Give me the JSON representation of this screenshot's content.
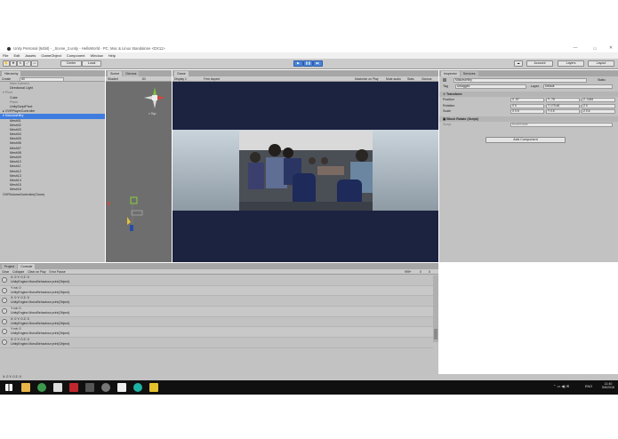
{
  "window": {
    "title": "Unity Personal (64bit) - _Scene_2.unity - HelloWorld - PC, Mac & Linux Standalone <DX11>",
    "minimize": "—",
    "maximize": "☐",
    "close": "✕"
  },
  "menu": [
    "File",
    "Edit",
    "Assets",
    "GameObject",
    "Component",
    "Window",
    "Help"
  ],
  "toolbar": {
    "pivot": "Center",
    "space": "Local",
    "account": "Account",
    "layers": "Layers",
    "layout": "Layout"
  },
  "hierarchy": {
    "tab": "Hierarchy",
    "create": "Create",
    "search_placeholder": "All",
    "items": [
      {
        "label": "Main Camera",
        "level": 1,
        "dim": true
      },
      {
        "label": "Directional Light",
        "level": 1,
        "dim": false
      },
      {
        "label": "▾ Pivot",
        "level": 0,
        "dim": true
      },
      {
        "label": "Cube",
        "level": 1,
        "dim": false
      },
      {
        "label": "Plane",
        "level": 1,
        "dim": true
      },
      {
        "label": "UnityScriptPivot",
        "level": 1,
        "dim": false
      },
      {
        "label": "▸ OVRPlayerController",
        "level": 0,
        "dim": false
      },
      {
        "label": "▾ MatureaHitry",
        "level": 0,
        "dim": false,
        "selected": true
      },
      {
        "label": "Mesh01",
        "level": 1
      },
      {
        "label": "Mesh02",
        "level": 1
      },
      {
        "label": "Mesh03",
        "level": 1
      },
      {
        "label": "Mesh04",
        "level": 1
      },
      {
        "label": "Mesh05",
        "level": 1
      },
      {
        "label": "Mesh06",
        "level": 1
      },
      {
        "label": "Mesh07",
        "level": 1
      },
      {
        "label": "Mesh08",
        "level": 1
      },
      {
        "label": "Mesh09",
        "level": 1
      },
      {
        "label": "Mesh10",
        "level": 1
      },
      {
        "label": "Mesh11",
        "level": 1
      },
      {
        "label": "Mesh12",
        "level": 1
      },
      {
        "label": "Mesh13",
        "level": 1
      },
      {
        "label": "Mesh14",
        "level": 1
      },
      {
        "label": "Mesh15",
        "level": 1
      },
      {
        "label": "Mesh16",
        "level": 1
      },
      {
        "label": "OVRVolumeController(Clone)",
        "level": 0
      }
    ]
  },
  "scene": {
    "tabs": [
      "Scene",
      "Gizmos",
      "Game"
    ],
    "shading": "Shaded",
    "mode_2d": "2D",
    "persp_label": "< Top",
    "tab_scene": "Scene",
    "tab_game": "Game"
  },
  "game": {
    "tab": "Game",
    "display": "Display 1",
    "aspect": "Free Aspect",
    "options": [
      "Maximize on Play",
      "Mute audio",
      "Stats",
      "Gizmos"
    ]
  },
  "inspector": {
    "tabs": [
      "Inspector",
      "Services"
    ],
    "object_name": "MatureaHitry",
    "static_label": "Static",
    "tag_label": "Tag",
    "tag_value": "Untagged",
    "layer_label": "Layer",
    "layer_value": "Default",
    "transform": {
      "header": "Transform",
      "position": {
        "label": "Position",
        "x": "X -57",
        "y": "Y -75",
        "z": "Z -1184"
      },
      "rotation": {
        "label": "Rotation",
        "x": "X 0",
        "y": "Y 179.48",
        "z": "Z 0"
      },
      "scale": {
        "label": "Scale",
        "x": "X 0.5",
        "y": "Y 0.5",
        "z": "Z 0.5"
      }
    },
    "script": {
      "header": "Block Rotate (Script)",
      "field_label": "Script",
      "field_value": "BlockRotate"
    },
    "add_component": "Add Component"
  },
  "console": {
    "tabs": [
      "Project",
      "Console"
    ],
    "buttons": [
      "Clear",
      "Collapse",
      "Clear on Play",
      "Error Pause"
    ],
    "counts": {
      "log": "999+",
      "warn": "0",
      "error": "0"
    },
    "rows": [
      {
        "line1": "X: 0 Y: 0 Z: 0",
        "line2": "UnityEngine.MonoBehaviour:print(Object)"
      },
      {
        "line1": "Y rot: 0",
        "line2": "UnityEngine.MonoBehaviour:print(Object)"
      },
      {
        "line1": "X: 0 Y: 0 Z: 0",
        "line2": "UnityEngine.MonoBehaviour:print(Object)"
      },
      {
        "line1": "Y rot: 0",
        "line2": "UnityEngine.MonoBehaviour:print(Object)"
      },
      {
        "line1": "X: 0 Y: 0 Z: 0",
        "line2": "UnityEngine.MonoBehaviour:print(Object)"
      },
      {
        "line1": "Y rot: 0",
        "line2": "UnityEngine.MonoBehaviour:print(Object)"
      },
      {
        "line1": "X: 0 Y: 0 Z: 0",
        "line2": "UnityEngine.MonoBehaviour:print(Object)"
      }
    ],
    "status": "X: 0 Y: 0 Z: 0"
  },
  "taskbar": {
    "time": "11:40",
    "date": "5/6/2016",
    "lang": "ENG"
  },
  "colors": {
    "selection": "#3e7ce0",
    "play_button": "#4a84d9",
    "game_bg": "#1b2340"
  }
}
